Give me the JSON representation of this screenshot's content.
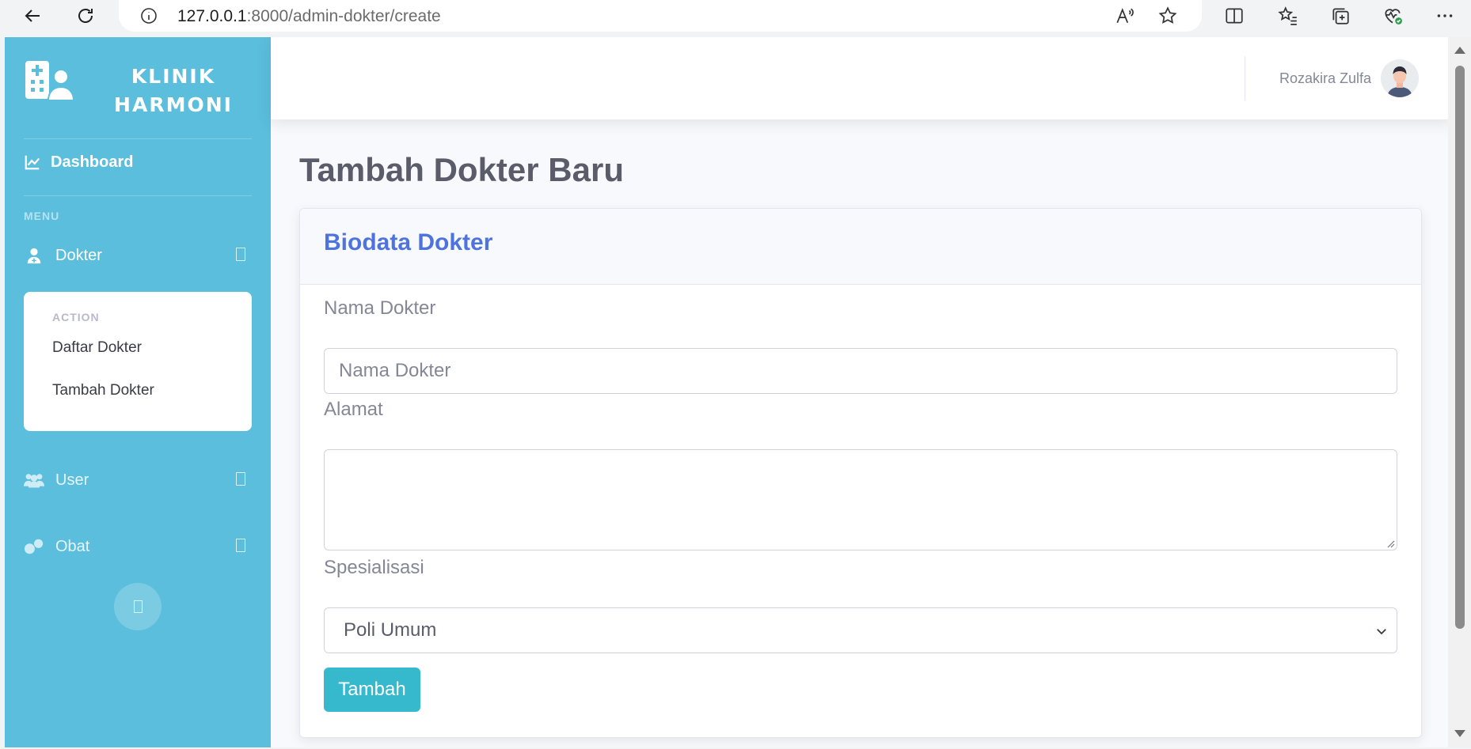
{
  "browser": {
    "url_host": "127.0.0.1",
    "url_rest": ":8000/admin-dokter/create"
  },
  "sidebar": {
    "brand_line1": "KLINIK",
    "brand_line2": "HARMONI",
    "dashboard_label": "Dashboard",
    "menu_heading": "MENU",
    "items": [
      {
        "label": "Dokter",
        "icon": "user-doctor-icon"
      },
      {
        "label": "User",
        "icon": "users-icon"
      },
      {
        "label": "Obat",
        "icon": "pills-icon"
      }
    ],
    "collapse": {
      "heading": "ACTION",
      "links": [
        "Daftar Dokter",
        "Tambah Dokter"
      ]
    }
  },
  "topbar": {
    "user_name": "Rozakira Zulfa"
  },
  "main": {
    "page_title": "Tambah Dokter Baru",
    "card_title": "Biodata Dokter",
    "form": {
      "nama_label": "Nama Dokter",
      "nama_placeholder": "Nama Dokter",
      "alamat_label": "Alamat",
      "alamat_value": "",
      "spesialisasi_label": "Spesialisasi",
      "spesialisasi_selected": "Poli Umum",
      "submit_label": "Tambah"
    }
  },
  "colors": {
    "sidebar": "#5bbedd",
    "card_title": "#4e73df",
    "submit": "#36b9cc"
  }
}
